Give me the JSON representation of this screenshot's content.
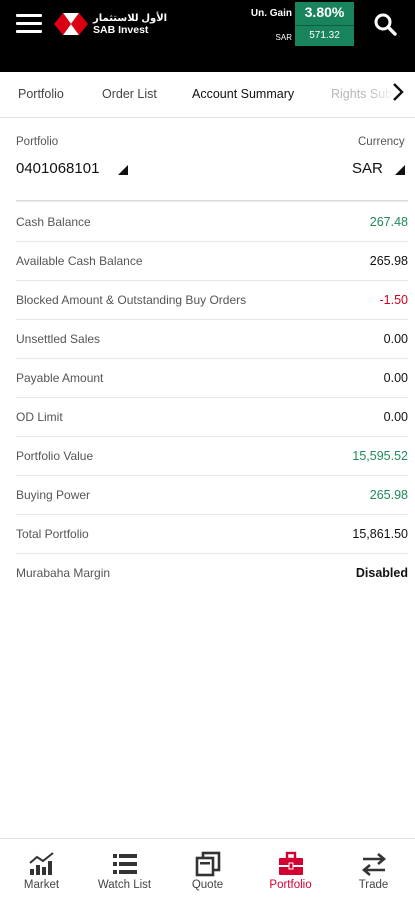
{
  "header": {
    "logo_arabic": "الأول للاستثمار",
    "logo_english": "SAB Invest",
    "gain_label": "Un. Gain",
    "gain_percent": "3.80%",
    "gain_currency": "SAR",
    "gain_value": "571.32",
    "colors": {
      "background": "#000000",
      "gain_box": "#19845c"
    },
    "icons": [
      "menu-icon",
      "sab-logo-icon",
      "search-icon"
    ]
  },
  "tabs": {
    "items": [
      "Portfolio",
      "Order List",
      "Account Summary",
      "Rights Subscr"
    ],
    "active": "Account Summary",
    "scroll_icon": "chevron-right-icon"
  },
  "selectors": {
    "portfolio_label": "Portfolio",
    "portfolio_value": "0401068101",
    "currency_label": "Currency",
    "currency_value": "SAR"
  },
  "summary": {
    "rows": [
      {
        "label": "Cash Balance",
        "value": "267.48",
        "tone": "positive"
      },
      {
        "label": "Available Cash Balance",
        "value": "265.98",
        "tone": "neutral"
      },
      {
        "label": "Blocked Amount & Outstanding Buy Orders",
        "value": "-1.50",
        "tone": "negative"
      },
      {
        "label": "Unsettled Sales",
        "value": "0.00",
        "tone": "neutral"
      },
      {
        "label": "Payable Amount",
        "value": "0.00",
        "tone": "neutral"
      },
      {
        "label": "OD Limit",
        "value": "0.00",
        "tone": "neutral"
      },
      {
        "label": "Portfolio Value",
        "value": "15,595.52",
        "tone": "positive"
      },
      {
        "label": "Buying Power",
        "value": "265.98",
        "tone": "positive"
      },
      {
        "label": "Total Portfolio",
        "value": "15,861.50",
        "tone": "neutral"
      },
      {
        "label": "Murabaha Margin",
        "value": "Disabled",
        "tone": "neutral"
      }
    ],
    "colors": {
      "positive": "#1e8a57",
      "negative": "#d0021b"
    }
  },
  "bottom_nav": {
    "items": [
      {
        "label": "Market",
        "icon": "bar-chart-icon"
      },
      {
        "label": "Watch List",
        "icon": "list-icon"
      },
      {
        "label": "Quote",
        "icon": "copy-icon"
      },
      {
        "label": "Portfolio",
        "icon": "briefcase-icon"
      },
      {
        "label": "Trade",
        "icon": "swap-arrows-icon"
      }
    ],
    "active": "Portfolio",
    "active_color": "#d50032"
  }
}
